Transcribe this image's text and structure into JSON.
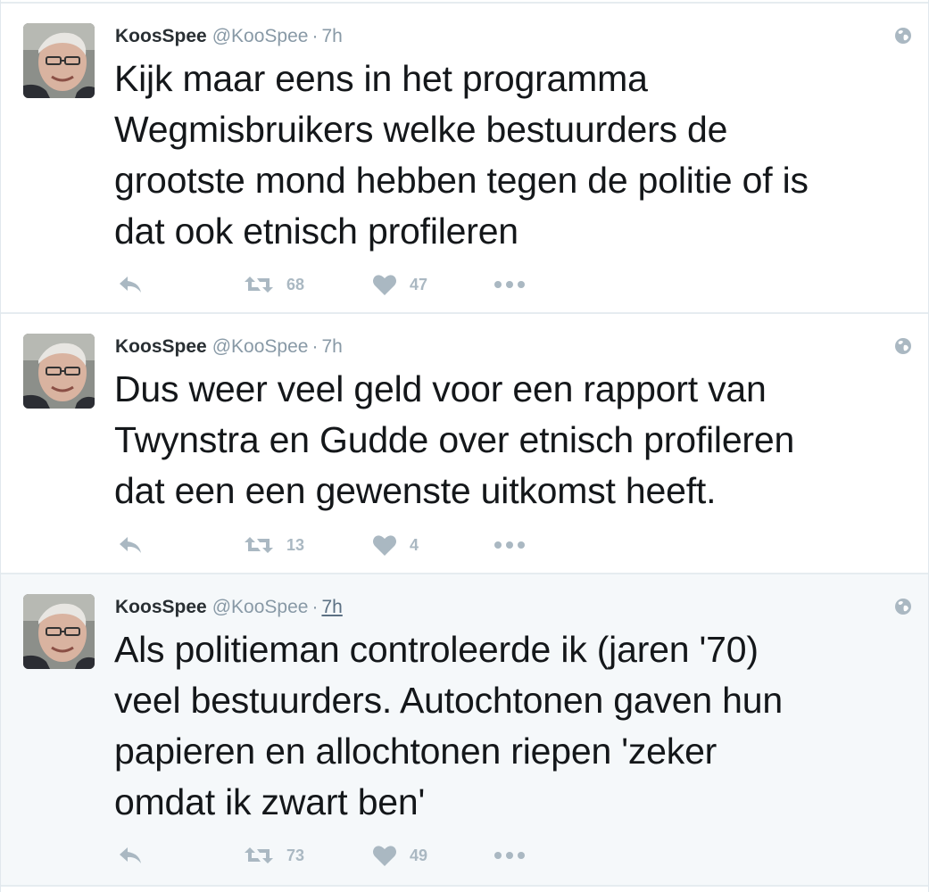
{
  "tweets": [
    {
      "fullname": "KoosSpee",
      "username": "@KooSpee",
      "separator": "·",
      "time": "7h",
      "text": "Kijk maar eens in het programma\nWegmisbruikers welke bestuurders de\ngrootste mond hebben tegen de politie of is\ndat ook etnisch profileren",
      "retweets": "68",
      "likes": "47"
    },
    {
      "fullname": "KoosSpee",
      "username": "@KooSpee",
      "separator": "·",
      "time": "7h",
      "text": "Dus weer veel geld voor een rapport van\nTwynstra en Gudde over etnisch profileren\ndat een een gewenste uitkomst heeft.",
      "retweets": "13",
      "likes": "4"
    },
    {
      "fullname": "KoosSpee",
      "username": "@KooSpee",
      "separator": "·",
      "time": "7h",
      "text": "Als politieman controleerde ik (jaren '70)\nveel bestuurders. Autochtonen gaven hun\npapieren en allochtonen riepen 'zeker\nomdat ik zwart ben'",
      "retweets": "73",
      "likes": "49"
    }
  ],
  "colors": {
    "text": "#14171a",
    "muted": "#8899a6",
    "icon": "#aab8c2",
    "border": "#e6ecf0",
    "hover_background": "#f5f8fa"
  },
  "icons": {
    "reply": "reply-arrow-icon",
    "retweet": "retweet-icon",
    "like": "heart-icon",
    "more": "more-dots-icon",
    "privacy": "globe-icon"
  }
}
